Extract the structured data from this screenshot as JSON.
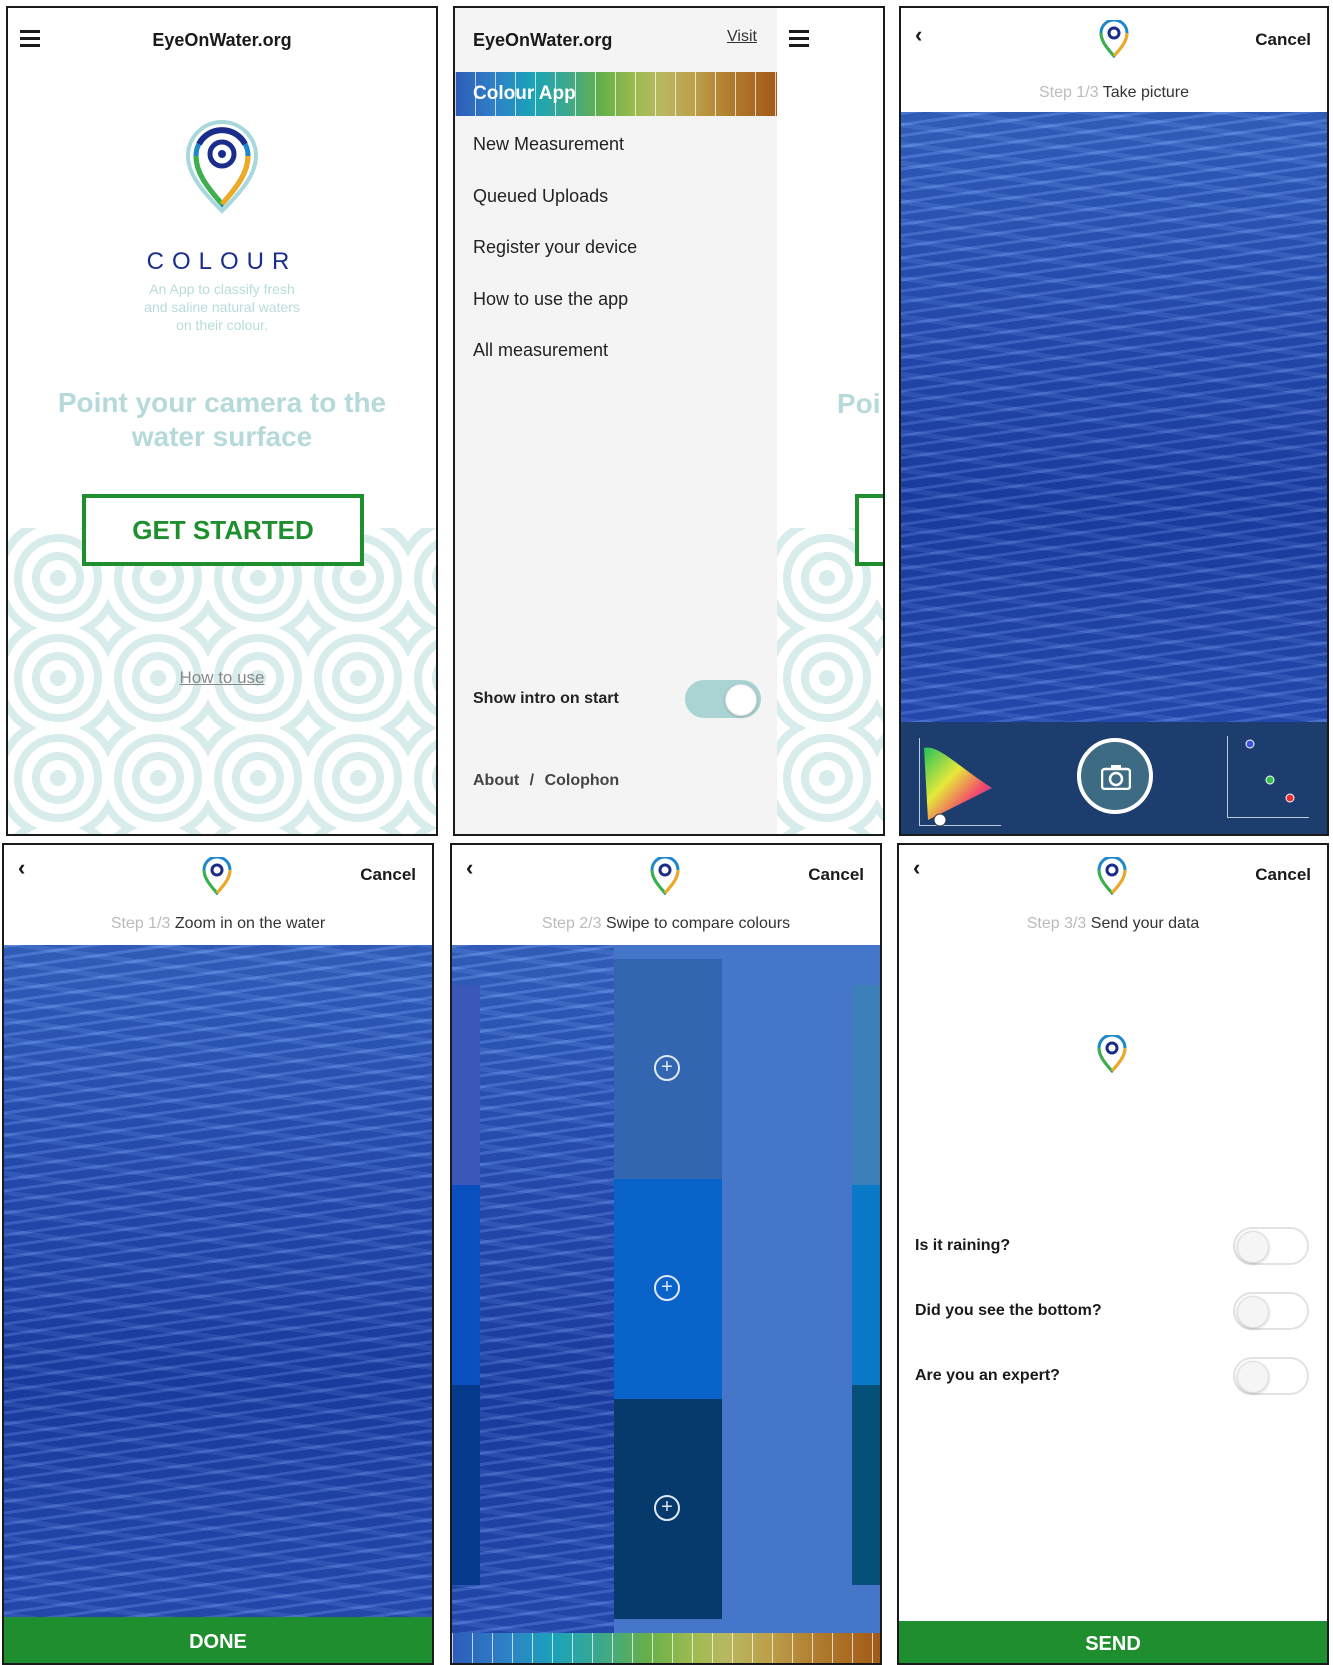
{
  "screen1": {
    "site_title": "EyeOnWater.org",
    "app_name": "COLOUR",
    "tagline_1": "An App to classify fresh",
    "tagline_2": "and saline natural waters",
    "tagline_3": "on their colour.",
    "headline_1": "Point your camera to the",
    "headline_2": "water surface",
    "get_started": "GET STARTED",
    "how_to_use": "How to use"
  },
  "screen2": {
    "site_title": "EyeOnWater.org",
    "visit_link": "Visit",
    "colour_app": "Colour App",
    "menu_items": [
      "New Measurement",
      "Queued Uploads",
      "Register your device",
      "How to use the app",
      "All measurement"
    ],
    "show_intro_label": "Show intro on start",
    "show_intro_on": true,
    "about": "About",
    "separator": "/",
    "colophon": "Colophon",
    "behind_text": "Poi"
  },
  "screen3": {
    "cancel": "Cancel",
    "step": "Step 1/3",
    "step_text": "Take picture"
  },
  "screen4": {
    "cancel": "Cancel",
    "step": "Step 1/3",
    "step_text": "Zoom in on the water",
    "done": "DONE"
  },
  "screen5": {
    "cancel": "Cancel",
    "step": "Step 2/3",
    "step_text": "Swipe to compare colours",
    "swatches": [
      "#3366b0",
      "#0a63c9",
      "#063a6c"
    ],
    "background_color": "#4676c9"
  },
  "screen6": {
    "cancel": "Cancel",
    "step": "Step 3/3",
    "step_text": "Send your data",
    "questions": [
      "Is it raining?",
      "Did you see the bottom?",
      "Are you an expert?"
    ],
    "send": "SEND"
  },
  "icons": {
    "menu": "hamburger-icon",
    "back": "chevron-left-icon",
    "camera": "camera-icon",
    "logo": "eyeonwater-pin-logo",
    "plus": "plus-circle-icon"
  },
  "colors": {
    "green": "#1f8e2e",
    "teal_light": "#aad4d4",
    "water_blue": "#2a57c4"
  }
}
